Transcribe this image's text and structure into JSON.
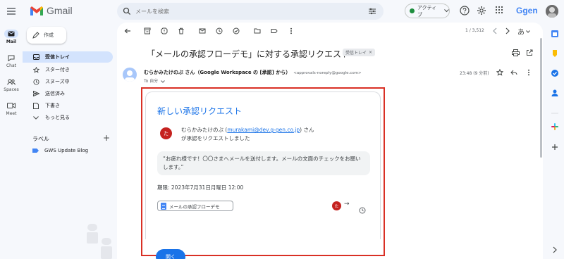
{
  "app": {
    "name": "Gmail",
    "brand": "Ggen"
  },
  "search": {
    "placeholder": "メールを検索"
  },
  "status": {
    "label": "アクティブ"
  },
  "rail": [
    {
      "label": "Mail"
    },
    {
      "label": "Chat"
    },
    {
      "label": "Spaces"
    },
    {
      "label": "Meet"
    }
  ],
  "nav": {
    "compose": "作成",
    "items": [
      {
        "label": "受信トレイ",
        "icon": "inbox-icon"
      },
      {
        "label": "スター付き",
        "icon": "star-icon"
      },
      {
        "label": "スヌーズ中",
        "icon": "clock-icon"
      },
      {
        "label": "送信済み",
        "icon": "send-icon"
      },
      {
        "label": "下書き",
        "icon": "draft-icon"
      },
      {
        "label": "もっと見る",
        "icon": "chevron-down-icon"
      }
    ],
    "labels_heading": "ラベル",
    "labels_add": "+",
    "labels": [
      {
        "label": "GWS Update Blog",
        "color": "#4285f4"
      }
    ]
  },
  "toolbar": {
    "count": "1 / 3,512",
    "lang": "あ"
  },
  "email": {
    "subject": "「メールの承認フローデモ」に対する承認リクエスト",
    "chip": "受信トレイ",
    "chip_close": "×",
    "sender_name": "むらかみたけのぶ さん（Google Workspace の [承認] から）",
    "sender_email": "<approvals-noreply@google.com>",
    "to": "To 自分",
    "time": "23:48 (9 分前)"
  },
  "card": {
    "title": "新しい承認リクエスト",
    "avatar_initial": "た",
    "requester": "むらかみたけのぶ",
    "requester_email": "murakami@dev.g-gen.co.jp",
    "request_suffix": "さんが承認をリクエストしました",
    "quote": "“お疲れ様です！〇〇さまへメールを送付します。メールの文面のチェックをお願いします。”",
    "deadline": "期限: 2023年7月31日月曜日 12:00",
    "doc_name": "メールの承認フローデモ",
    "flow_arrow": "→",
    "open_button": "開く"
  },
  "colors": {
    "accent": "#1a73e8",
    "highlight": "#d93025",
    "nav_active": "#d3e3fd"
  }
}
